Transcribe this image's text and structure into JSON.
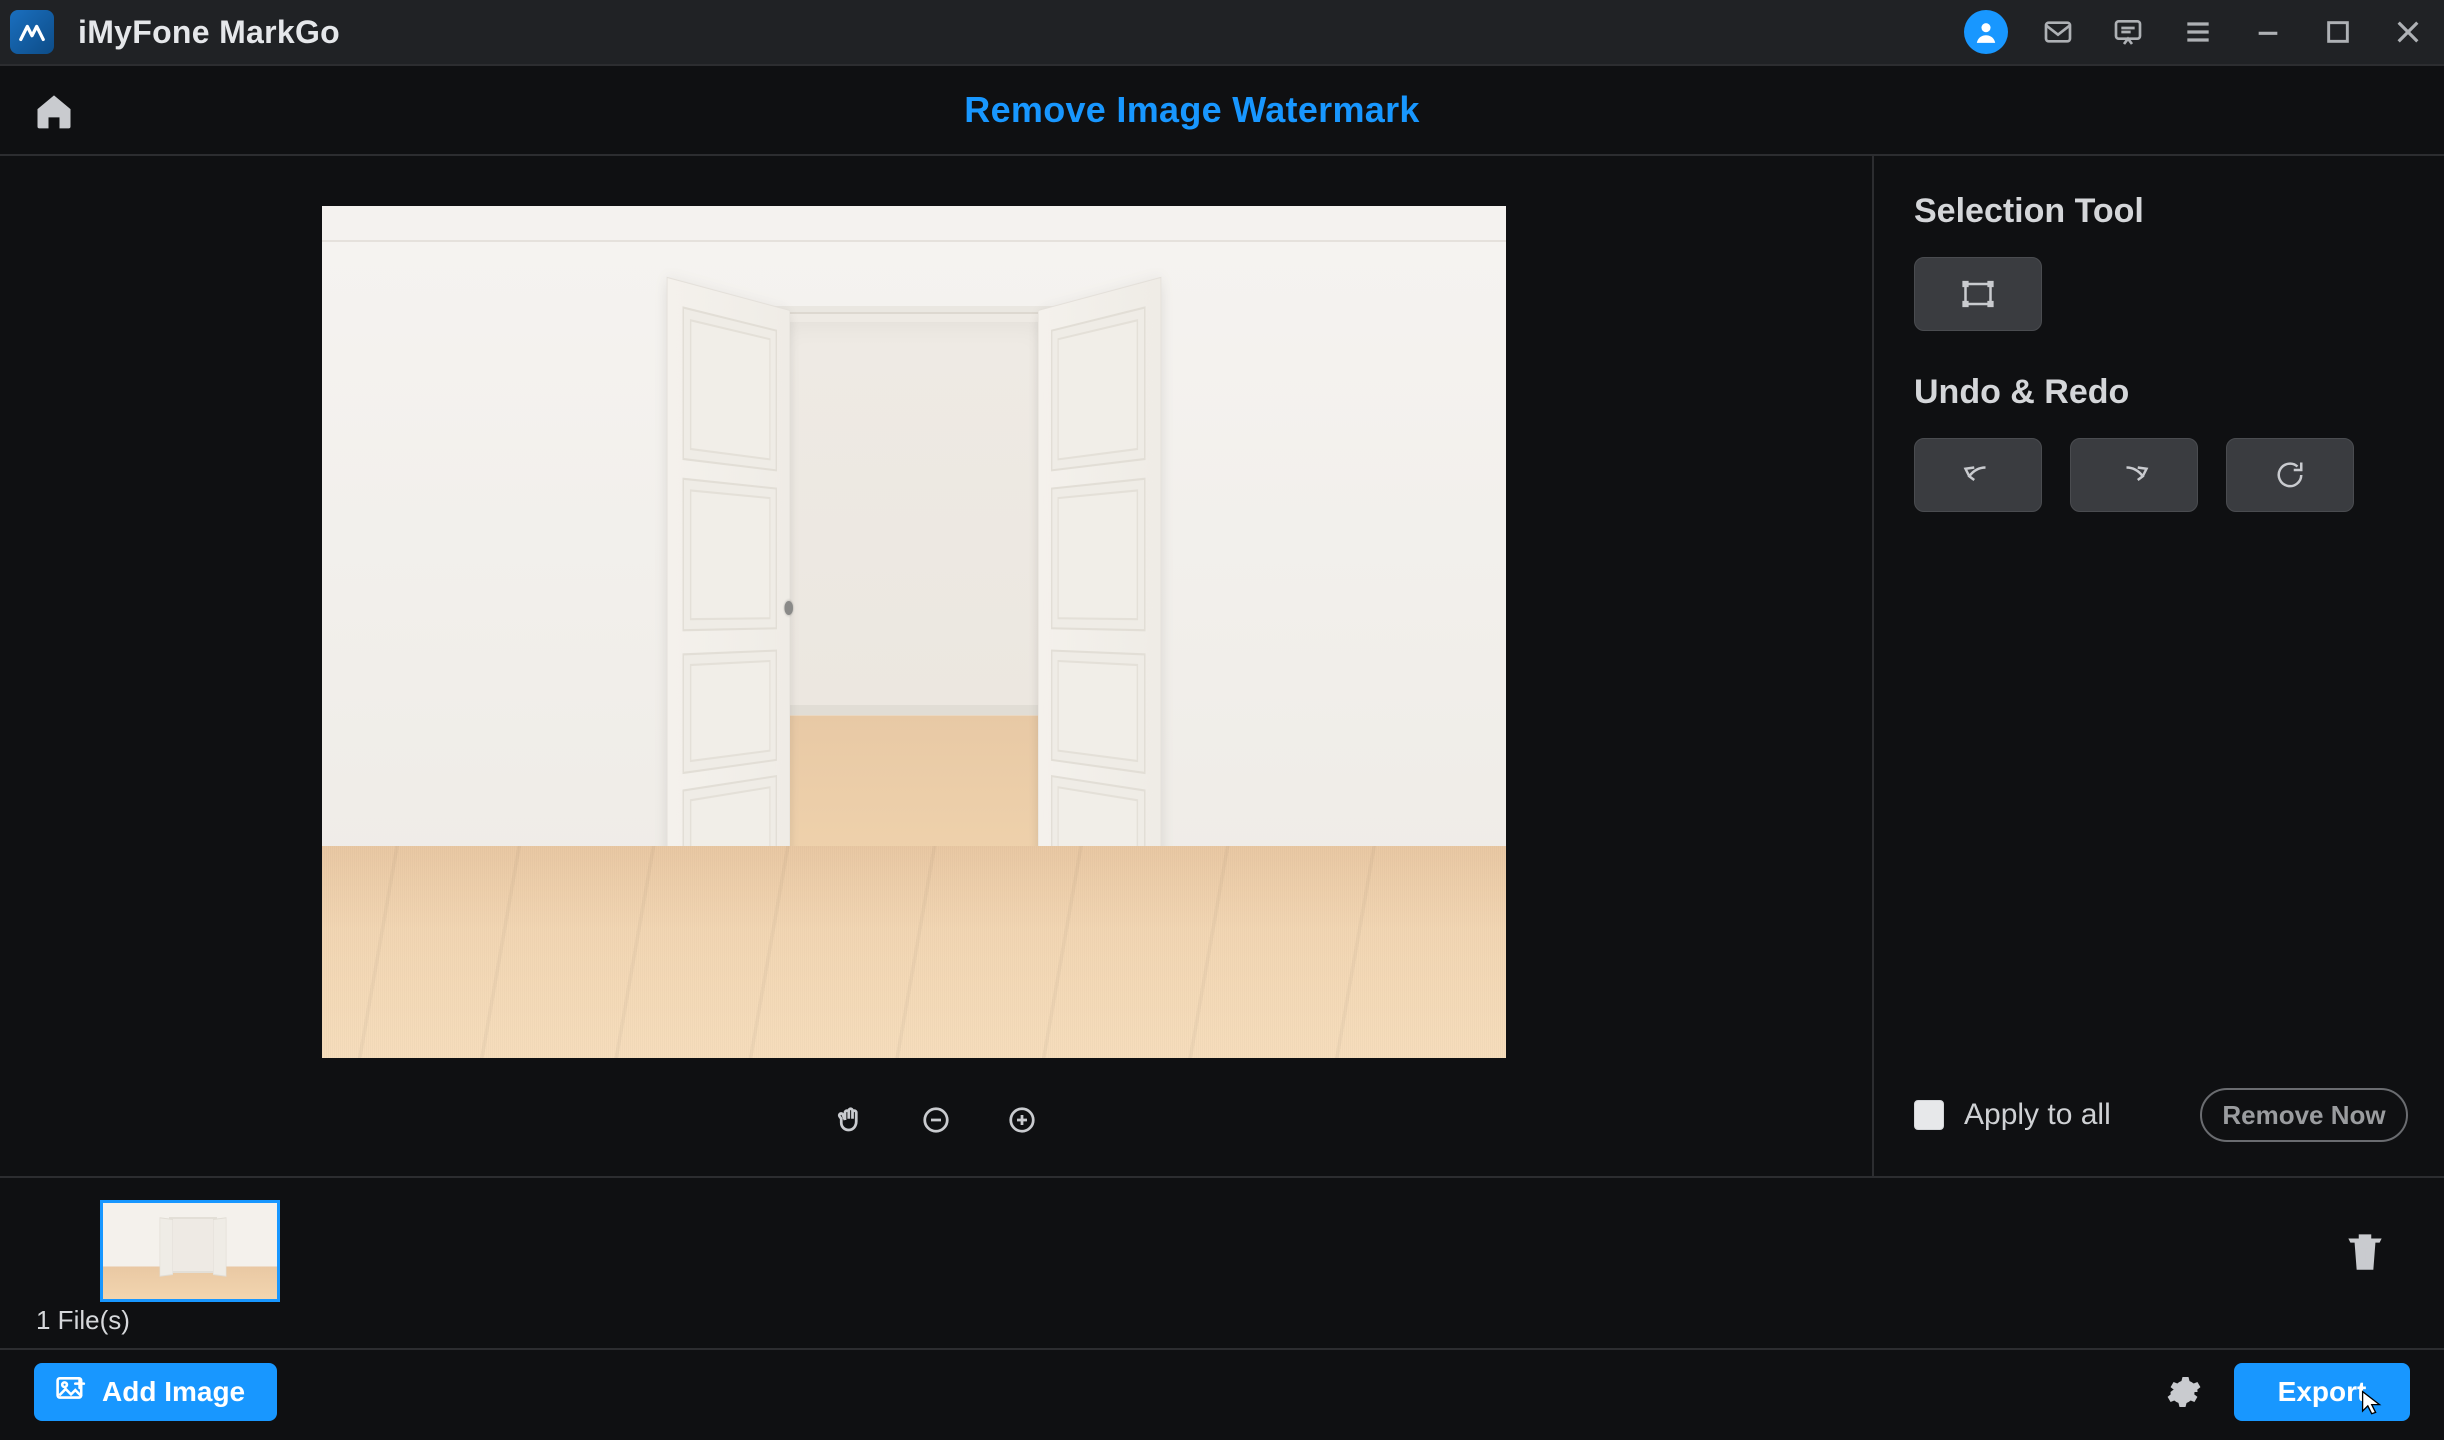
{
  "titlebar": {
    "app_name": "iMyFone MarkGo"
  },
  "modebar": {
    "title": "Remove Image Watermark"
  },
  "sidepanel": {
    "selection_heading": "Selection Tool",
    "undo_heading": "Undo & Redo",
    "apply_to_all": "Apply to all",
    "remove_now": "Remove Now"
  },
  "thumbstrip": {
    "file_count": "1 File(s)"
  },
  "bottombar": {
    "add_image": "Add Image",
    "export": "Export"
  },
  "colors": {
    "accent": "#1897ff",
    "panel_button": "#3a3c40"
  }
}
